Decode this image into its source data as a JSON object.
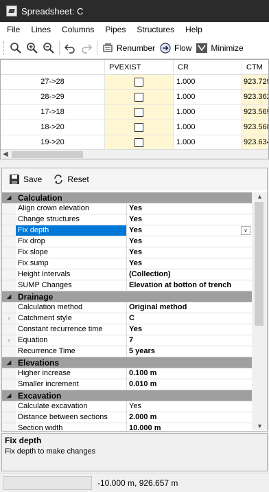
{
  "window": {
    "title": "Spreadsheet: C"
  },
  "menu": [
    "File",
    "Lines",
    "Columns",
    "Pipes",
    "Structures",
    "Help"
  ],
  "toolbar": {
    "zoom_icons": [
      "zoom-icon",
      "zoom-in-icon",
      "zoom-out-icon"
    ],
    "undo_icons": [
      "undo-icon",
      "redo-icon"
    ],
    "renumber_label": "Renumber",
    "flow_label": "Flow",
    "minimize_label": "Minimize"
  },
  "spreadsheet": {
    "columns": [
      "",
      "PVEXIST",
      "CR",
      "CTM"
    ],
    "rows": [
      {
        "name": "27->28",
        "pvexist": false,
        "cr": "1.000",
        "ctm": "923.729"
      },
      {
        "name": "28->29",
        "pvexist": false,
        "cr": "1.000",
        "ctm": "923.362"
      },
      {
        "name": "17->18",
        "pvexist": false,
        "cr": "1.000",
        "ctm": "923.569"
      },
      {
        "name": "18->20",
        "pvexist": false,
        "cr": "1.000",
        "ctm": "923.568"
      },
      {
        "name": "19->20",
        "pvexist": false,
        "cr": "1.000",
        "ctm": "923.634"
      }
    ]
  },
  "properties": {
    "save_label": "Save",
    "reset_label": "Reset",
    "categories": [
      {
        "label": "Calculation",
        "rows": [
          {
            "name": "Align crown elevation",
            "value": "Yes"
          },
          {
            "name": "Change structures",
            "value": "Yes"
          },
          {
            "name": "Fix depth",
            "value": "Yes",
            "selected": true,
            "dropdown": true
          },
          {
            "name": "Fix drop",
            "value": "Yes"
          },
          {
            "name": "Fix slope",
            "value": "Yes"
          },
          {
            "name": "Fix sump",
            "value": "Yes"
          },
          {
            "name": "Height Intervals",
            "value": "(Collection)"
          },
          {
            "name": "SUMP Changes",
            "value": "Elevation at botton of trench"
          }
        ]
      },
      {
        "label": "Drainage",
        "rows": [
          {
            "name": "Calculation method",
            "value": "Original method"
          },
          {
            "name": "Catchment style",
            "value": "C",
            "expandable": true
          },
          {
            "name": "Constant recurrence time",
            "value": "Yes"
          },
          {
            "name": "Equation",
            "value": "7",
            "expandable": true
          },
          {
            "name": "Recurrence Time",
            "value": "5 years"
          }
        ]
      },
      {
        "label": "Elevations",
        "rows": [
          {
            "name": "Higher increase",
            "value": "0.100 m"
          },
          {
            "name": "Smaller increment",
            "value": "0.010 m"
          }
        ]
      },
      {
        "label": "Excavation",
        "rows": [
          {
            "name": "Calculate excavation",
            "value": "Yes",
            "plain": true
          },
          {
            "name": "Distance between sections",
            "value": "2.000 m"
          },
          {
            "name": "Section width",
            "value": "10.000 m"
          }
        ]
      }
    ]
  },
  "description": {
    "title": "Fix depth",
    "text": "Fix depth to make changes"
  },
  "status": {
    "coordinates": "-10.000 m, 926.657 m"
  }
}
